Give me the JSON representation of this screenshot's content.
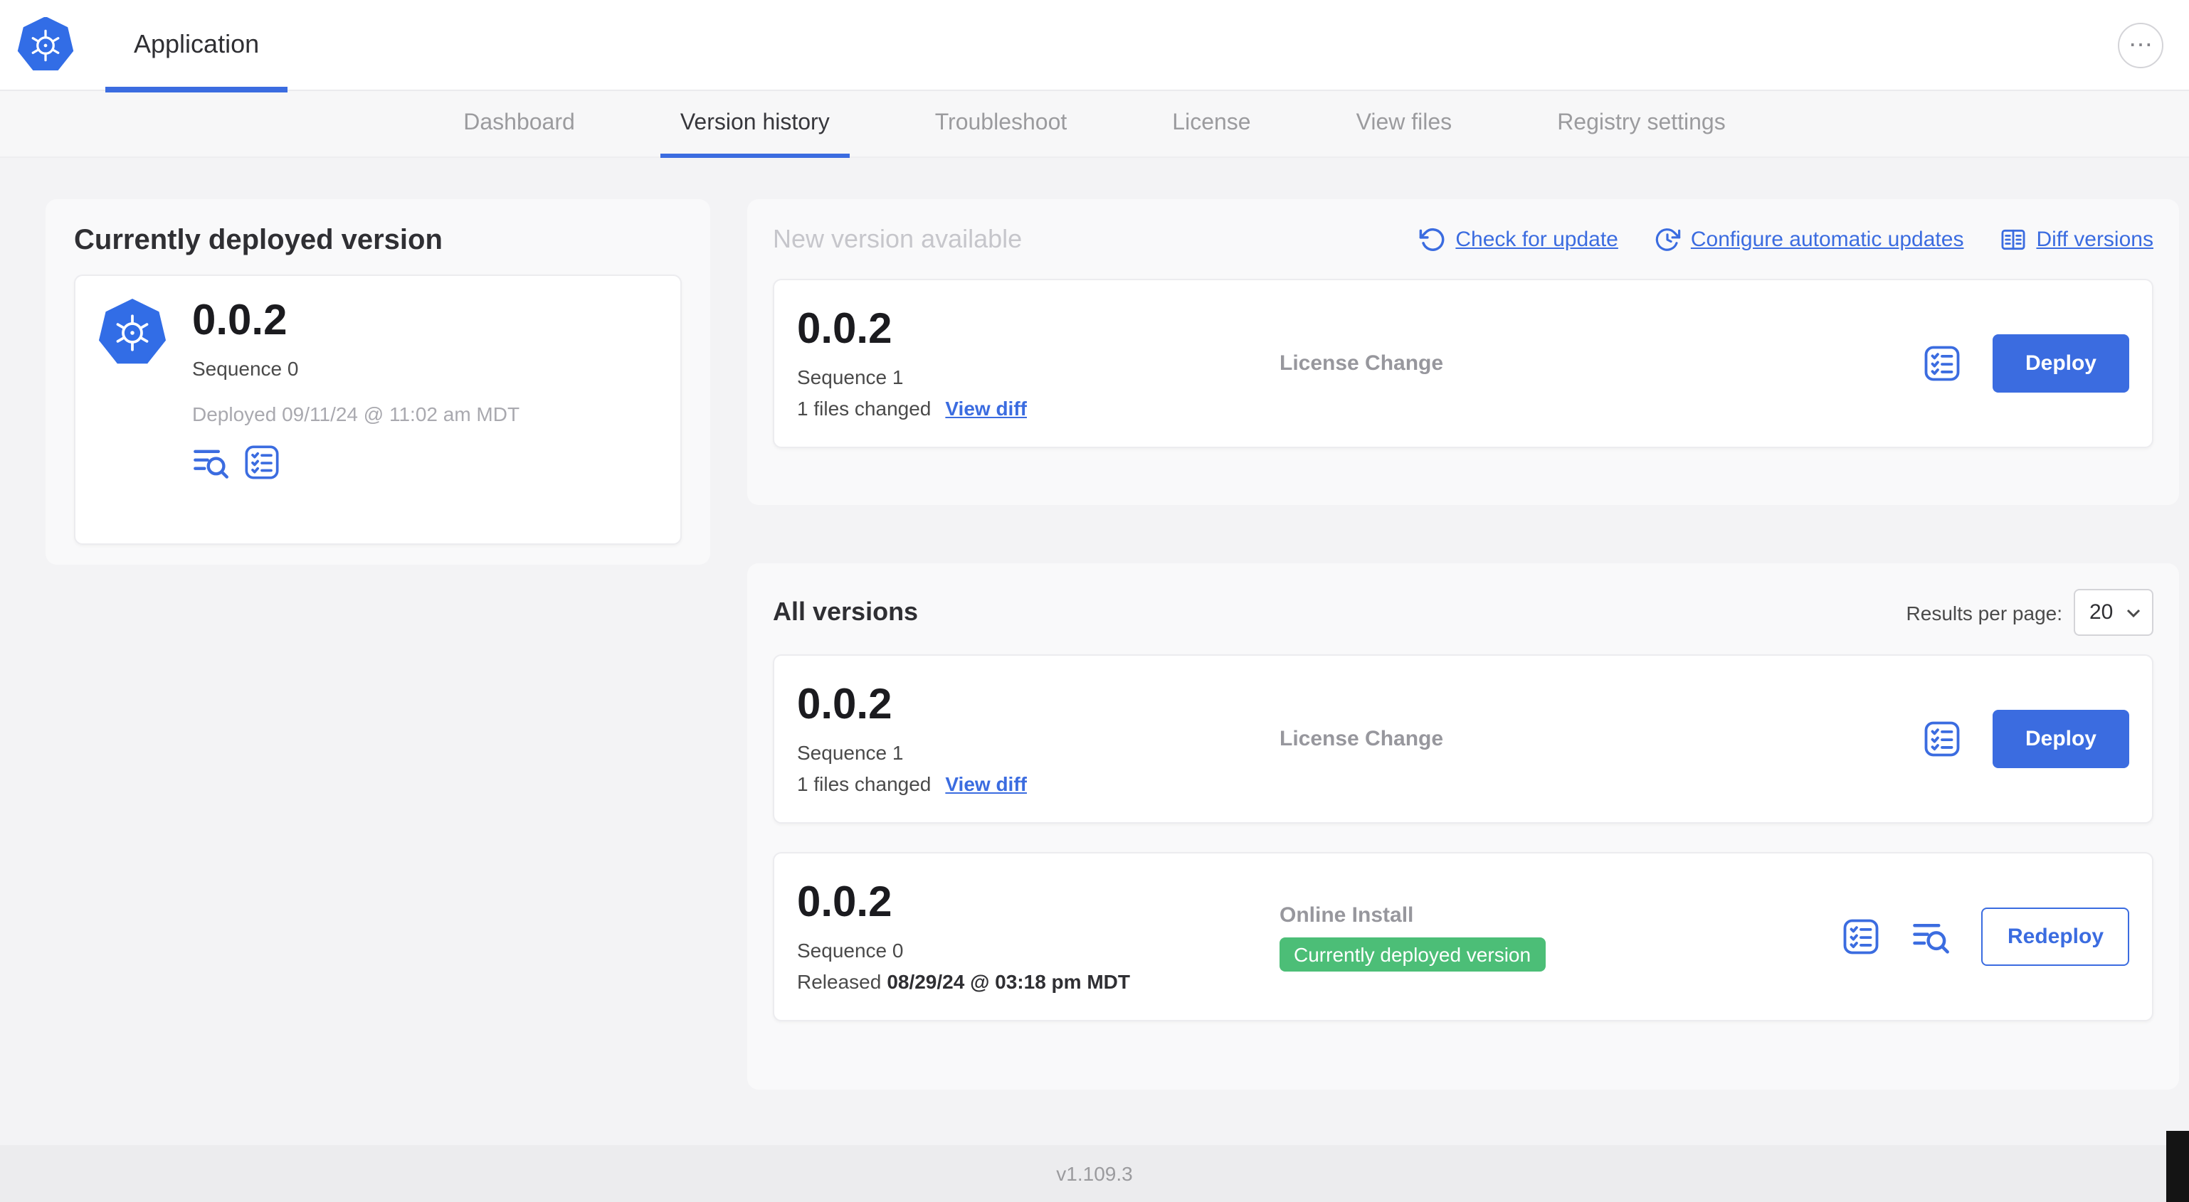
{
  "header": {
    "app_tab": "Application"
  },
  "icons": {
    "ellipsis": "⋯"
  },
  "nav": {
    "tabs": [
      {
        "label": "Dashboard"
      },
      {
        "label": "Version history"
      },
      {
        "label": "Troubleshoot"
      },
      {
        "label": "License"
      },
      {
        "label": "View files"
      },
      {
        "label": "Registry settings"
      }
    ]
  },
  "current_version": {
    "title": "Currently deployed version",
    "version": "0.0.2",
    "sequence": "Sequence 0",
    "deployed_at": "Deployed 09/11/24 @ 11:02 am MDT"
  },
  "new_version": {
    "title": "New version available",
    "check_for_update": "Check for update",
    "configure_updates": "Configure automatic updates",
    "diff_versions": "Diff versions",
    "card": {
      "version": "0.0.2",
      "sequence": "Sequence 1",
      "files_changed": "1 files changed",
      "view_diff": "View diff",
      "source": "License Change",
      "deploy": "Deploy"
    }
  },
  "all_versions": {
    "title": "All versions",
    "results_per_page_label": "Results per page:",
    "results_per_page": "20",
    "rows": [
      {
        "version": "0.0.2",
        "sequence": "Sequence 1",
        "files_changed": "1 files changed",
        "view_diff": "View diff",
        "source": "License Change",
        "action": "Deploy"
      },
      {
        "version": "0.0.2",
        "sequence": "Sequence 0",
        "released_prefix": "Released",
        "released_date": "08/29/24 @ 03:18 pm MDT",
        "source": "Online Install",
        "badge": "Currently deployed version",
        "action": "Redeploy"
      }
    ]
  },
  "footer": {
    "version": "v1.109.3"
  },
  "colors": {
    "primary_blue": "#3b6ce0",
    "kubernetes_blue": "#326de6",
    "badge_green": "#4cbe77",
    "page_background": "#f3f3f5"
  }
}
